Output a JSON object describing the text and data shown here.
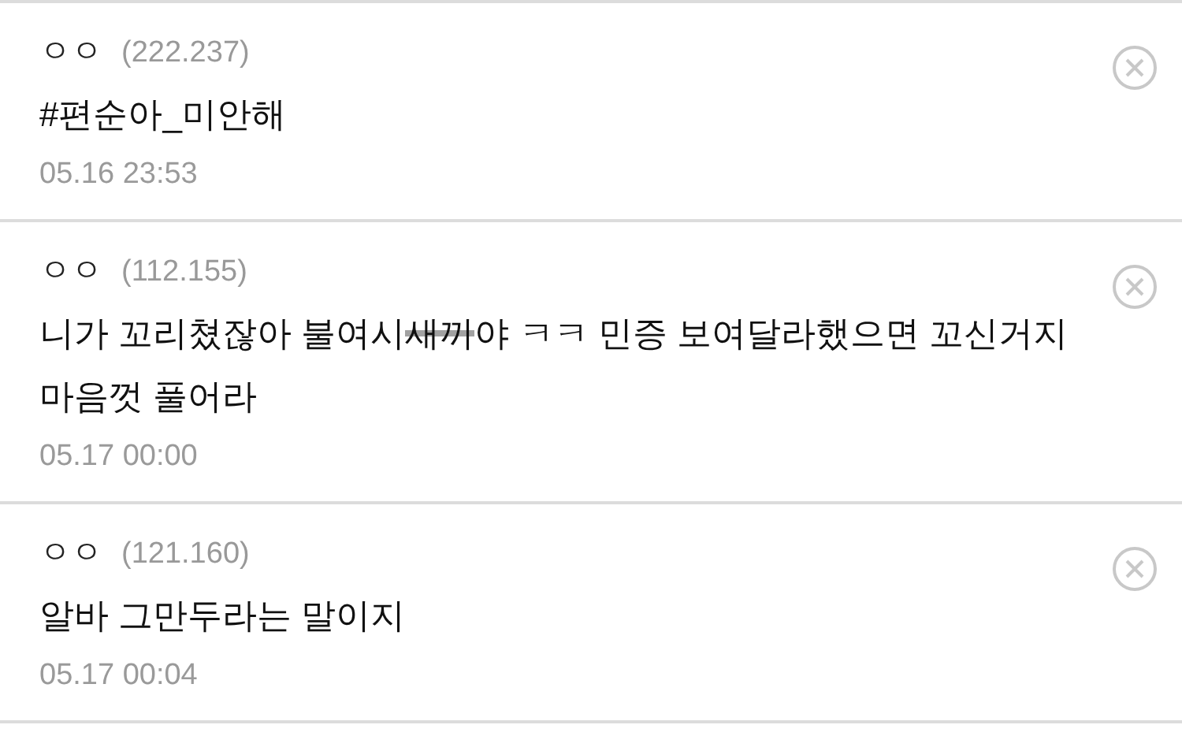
{
  "comments": [
    {
      "author": "ㅇㅇ",
      "ip": "(222.237)",
      "segments": [
        {
          "text": "#편순아_미안해",
          "censored": false
        }
      ],
      "time": "05.16 23:53"
    },
    {
      "author": "ㅇㅇ",
      "ip": "(112.155)",
      "segments": [
        {
          "text": "니가 꼬리쳤잖아 불여시",
          "censored": false
        },
        {
          "text": "새끼",
          "censored": true
        },
        {
          "text": "야 ㅋㅋ 민증 보여달라했으면 꼬신거지 마음껏 풀어라",
          "censored": false
        }
      ],
      "time": "05.17 00:00"
    },
    {
      "author": "ㅇㅇ",
      "ip": "(121.160)",
      "segments": [
        {
          "text": "알바 그만두라는 말이지",
          "censored": false
        }
      ],
      "time": "05.17 00:04"
    }
  ]
}
